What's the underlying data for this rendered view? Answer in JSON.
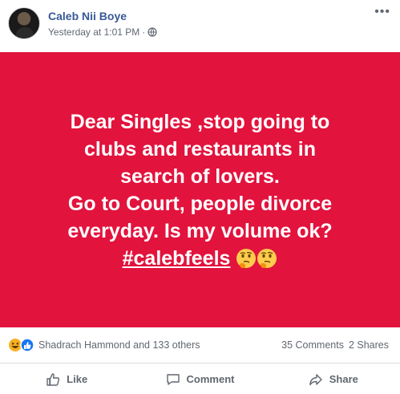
{
  "post": {
    "author": "Caleb Nii Boye",
    "timestamp": "Yesterday at 1:01 PM",
    "separator": "·",
    "privacy_icon": "globe-icon",
    "more_label": "•••"
  },
  "card": {
    "background": "#e2133d",
    "text_color": "#ffffff",
    "lines": [
      "Dear Singles ,stop going to",
      "clubs and restaurants in",
      "search of lovers.",
      "Go to Court, people divorce",
      "everyday. Is my volume ok?"
    ],
    "hashtag": "#calebfeels",
    "emoji": [
      "thinking-face-icon",
      "thinking-face-icon"
    ]
  },
  "reactions": {
    "icons": [
      "haha-icon",
      "like-icon"
    ],
    "summary": "Shadrach Hammond and 133 others",
    "comments": "35 Comments",
    "shares": "2 Shares"
  },
  "actions": {
    "like": "Like",
    "comment": "Comment",
    "share": "Share"
  },
  "colors": {
    "link_blue": "#385898",
    "meta_gray": "#606770"
  }
}
